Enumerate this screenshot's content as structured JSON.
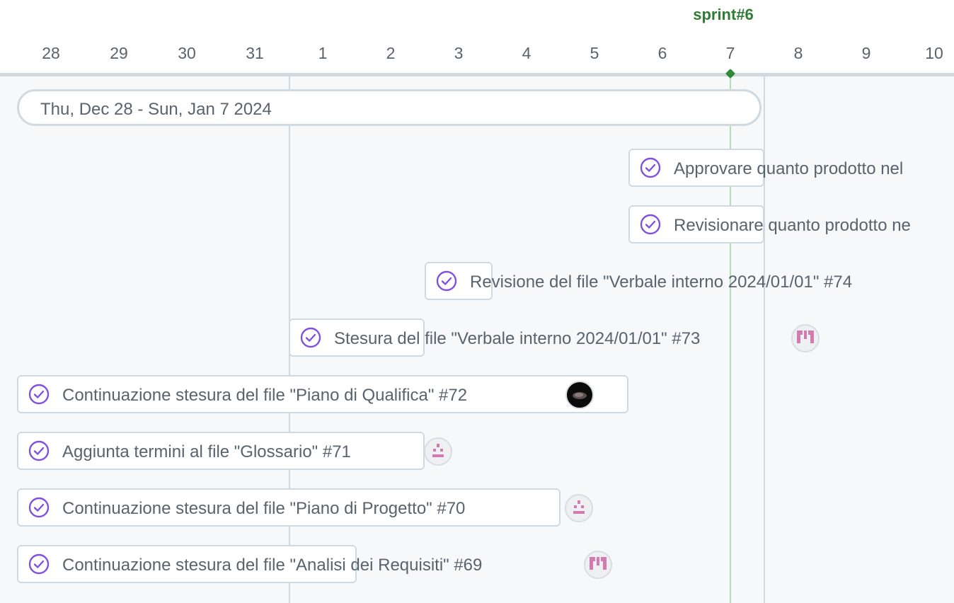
{
  "timeline": {
    "days": [
      "28",
      "29",
      "30",
      "31",
      "1",
      "2",
      "3",
      "4",
      "5",
      "6",
      "7",
      "8",
      "9",
      "10"
    ],
    "sprint_label": "sprint#6",
    "range_label": "Thu, Dec 28 - Sun, Jan 7 2024"
  },
  "items": [
    {
      "title": "Approvare quanto prodotto nel"
    },
    {
      "title": "Revisionare quanto prodotto ne"
    },
    {
      "title": "Revisione del file \"Verbale interno 2024/01/01\" #74"
    },
    {
      "title": "Stesura del file \"Verbale interno 2024/01/01\" #73"
    },
    {
      "title": "Continuazione stesura del file \"Piano di Qualifica\" #72"
    },
    {
      "title": "Aggiunta termini al file \"Glossario\" #71"
    },
    {
      "title": "Continuazione stesura del file \"Piano di Progetto\" #70"
    },
    {
      "title": "Continuazione stesura del file \"Analisi dei Requisiti\" #69"
    }
  ],
  "colors": {
    "check": "#8250df",
    "sprint": "#2f7d32",
    "identicon_pink": "#d37bb1"
  },
  "icons": {
    "status": "issue-closed-check-icon"
  }
}
